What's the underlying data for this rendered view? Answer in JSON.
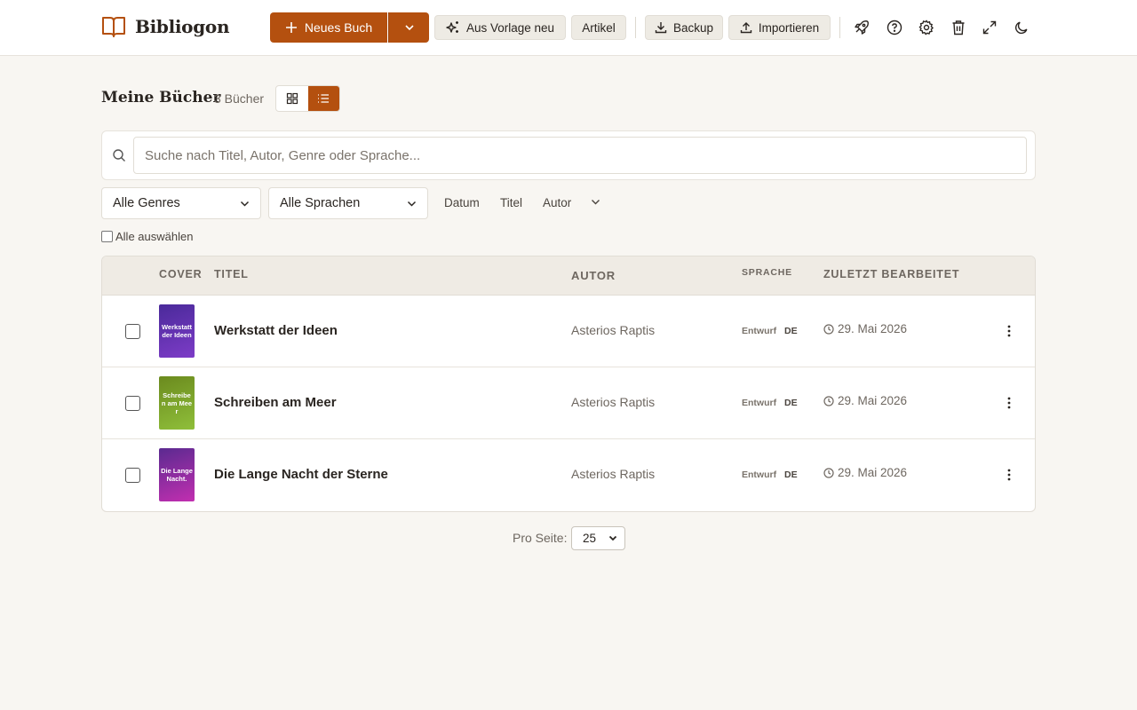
{
  "app": {
    "name": "Bibliogon"
  },
  "toolbar": {
    "new_book": "Neues Buch",
    "from_template": "Aus Vorlage neu",
    "article": "Artikel",
    "backup": "Backup",
    "import": "Importieren"
  },
  "colors": {
    "accent": "#b4500f",
    "background": "#f8f6f2"
  },
  "library": {
    "title": "Meine Bücher",
    "count": "3 Bücher",
    "view": "list"
  },
  "search": {
    "placeholder": "Suche nach Titel, Autor, Genre oder Sprache...",
    "value": ""
  },
  "filters": {
    "genre": "Alle Genres",
    "language": "Alle Sprachen",
    "sort": [
      "Datum",
      "Titel",
      "Autor"
    ]
  },
  "select_all": "Alle auswählen",
  "table": {
    "headers": {
      "cover": "COVER",
      "title": "TITEL",
      "author": "AUTOR",
      "language": "SPRACHE",
      "edited": "ZULETZT BEARBEITET"
    },
    "rows": [
      {
        "cover_text": "Werkstatt der Ideen",
        "cover_colors": [
          "#4a2a9a",
          "#7d3cc7"
        ],
        "title": "Werkstatt der Ideen",
        "author": "Asterios Raptis",
        "status": "Entwurf",
        "lang": "DE",
        "date": "29. Mai 2026"
      },
      {
        "cover_text": "Schreiben am Meer",
        "cover_colors": [
          "#6b8a1e",
          "#8fbf3a"
        ],
        "title": "Schreiben am Meer",
        "author": "Asterios Raptis",
        "status": "Entwurf",
        "lang": "DE",
        "date": "29. Mai 2026"
      },
      {
        "cover_text": "Die Lange Nacht.",
        "cover_colors": [
          "#5a2a90",
          "#c22fb0"
        ],
        "title": "Die Lange Nacht der Sterne",
        "author": "Asterios Raptis",
        "status": "Entwurf",
        "lang": "DE",
        "date": "29. Mai 2026"
      }
    ]
  },
  "pagination": {
    "label": "Pro Seite:",
    "per_page": "25"
  }
}
